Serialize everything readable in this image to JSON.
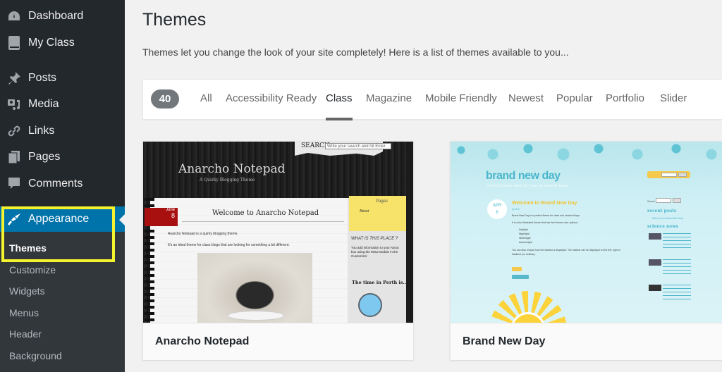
{
  "sidebar": {
    "items": [
      {
        "label": "Dashboard",
        "icon": "dashboard-icon"
      },
      {
        "label": "My Class",
        "icon": "book-icon"
      },
      {
        "label": "Posts",
        "icon": "pushpin-icon"
      },
      {
        "label": "Media",
        "icon": "media-icon"
      },
      {
        "label": "Links",
        "icon": "link-icon"
      },
      {
        "label": "Pages",
        "icon": "pages-icon"
      },
      {
        "label": "Comments",
        "icon": "comment-icon"
      },
      {
        "label": "Appearance",
        "icon": "paintbrush-icon",
        "active": true
      }
    ],
    "submenu": [
      {
        "label": "Themes",
        "current": true
      },
      {
        "label": "Customize"
      },
      {
        "label": "Widgets"
      },
      {
        "label": "Menus"
      },
      {
        "label": "Header"
      },
      {
        "label": "Background"
      }
    ],
    "highlight_color": "#f4f32d",
    "active_color": "#0073aa"
  },
  "page": {
    "title": "Themes",
    "description": "Themes let you change the look of your site completely! Here is a list of themes available to you..."
  },
  "filter": {
    "count": "40",
    "tabs": [
      {
        "label": "All"
      },
      {
        "label": "Accessibility Ready"
      },
      {
        "label": "Class",
        "current": true
      },
      {
        "label": "Magazine"
      },
      {
        "label": "Mobile Friendly"
      },
      {
        "label": "Newest"
      },
      {
        "label": "Popular"
      },
      {
        "label": "Portfolio"
      },
      {
        "label": "Slider"
      }
    ]
  },
  "themes": [
    {
      "name": "Anarcho Notepad",
      "preview": {
        "site_title": "Anarcho Notepad",
        "tagline": "A Quirky Blogging Theme",
        "search_label": "SEARCH",
        "search_placeholder": "Write your search and hit Enter",
        "date_month": "June",
        "date_day": "8",
        "post_title": "Welcome to Anarcho Notepad",
        "paragraph_1": "Anarcho Notepad is a quirky blogging theme.",
        "paragraph_2": "It's an ideal theme for class blogs that are looking for something a bit different.",
        "sticky_heading": "Pages",
        "sticky_link": "About",
        "widget_heading": "WHAT IS THIS PLACE ?",
        "widget_text": "You add information to your About box using the Meta Module in the Customizer",
        "clock_heading": "The time in Perth is..."
      }
    },
    {
      "name": "Brand New Day",
      "preview": {
        "site_title": "brand new day",
        "tagline": "Colorful theme ideal for class & student blogs",
        "date_month": "APR",
        "date_day": "6",
        "post_title": "Welcome to Brand New Day",
        "by_line": "by Sue",
        "paragraph_1": "Brand New Day is a perfect theme for class and student blogs.",
        "paragraph_2": "It is a fun illustrated theme that has four theme color options:",
        "color_options": [
          "Daylight",
          "Nightlight",
          "Winterlight",
          "Autumnlight"
        ],
        "paragraph_3": "You can also choose how the sidebar is displayed. The sidebar can be displayed on the left, right or",
        "paragraph_4": "disabled (no sidebar).",
        "sidebar_search_label": "Search",
        "sidebar_search_button": "Go",
        "recent_posts_heading": "recent posts",
        "recent_post_item": "Welcome to Brand New Day",
        "science_news_heading": "science news"
      }
    }
  ]
}
